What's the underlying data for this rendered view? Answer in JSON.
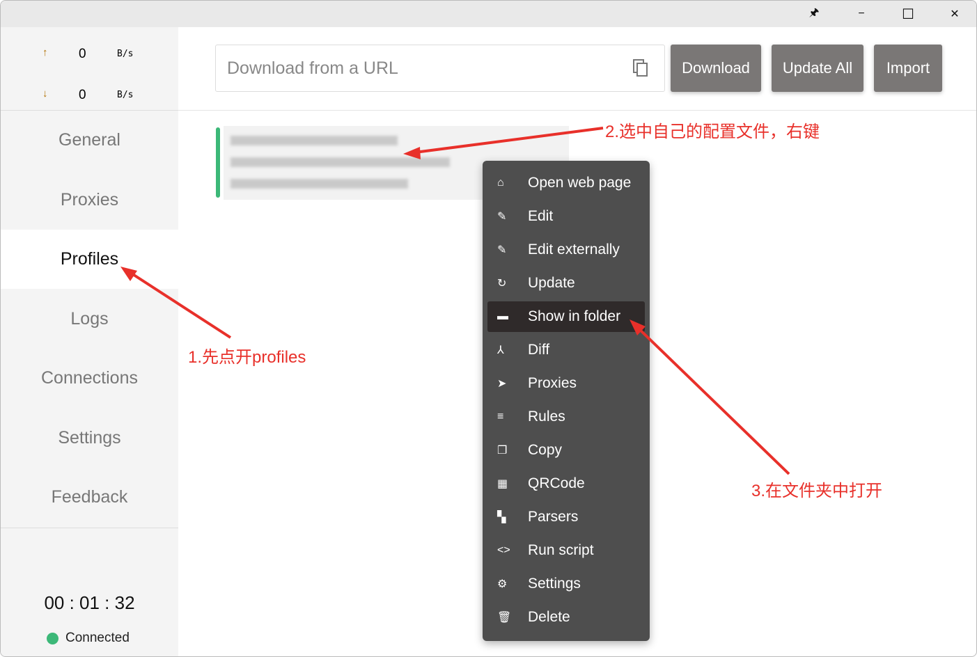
{
  "window": {
    "pin": "🖈",
    "minimize": "−",
    "maximize": "☐",
    "close": "✕"
  },
  "speed": {
    "up": {
      "arrow": "↑",
      "value": "0",
      "unit": "B/s"
    },
    "down": {
      "arrow": "↓",
      "value": "0",
      "unit": "B/s"
    }
  },
  "nav": [
    "General",
    "Proxies",
    "Profiles",
    "Logs",
    "Connections",
    "Settings",
    "Feedback"
  ],
  "active_nav": "Profiles",
  "uptime": "00 : 01 : 32",
  "status": "Connected",
  "toolbar": {
    "url_placeholder": "Download from a URL",
    "download": "Download",
    "update_all": "Update All",
    "import": "Import"
  },
  "menu": [
    {
      "icon": "home",
      "label": "Open web page"
    },
    {
      "icon": "pencil",
      "label": "Edit"
    },
    {
      "icon": "pencil",
      "label": "Edit externally"
    },
    {
      "icon": "refresh",
      "label": "Update"
    },
    {
      "icon": "folder",
      "label": "Show in folder"
    },
    {
      "icon": "merge",
      "label": "Diff"
    },
    {
      "icon": "send",
      "label": "Proxies"
    },
    {
      "icon": "rules",
      "label": "Rules"
    },
    {
      "icon": "copy",
      "label": "Copy"
    },
    {
      "icon": "qrcode",
      "label": "QRCode"
    },
    {
      "icon": "sitemap",
      "label": "Parsers"
    },
    {
      "icon": "code",
      "label": "Run script"
    },
    {
      "icon": "gear",
      "label": "Settings"
    },
    {
      "icon": "trash",
      "label": "Delete"
    }
  ],
  "annotations": {
    "a1": "1.先点开profiles",
    "a2": "2.选中自己的配置文件，右键",
    "a3": "3.在文件夹中打开"
  },
  "colors": {
    "accent": "#3cb878",
    "annotation": "#e8302a",
    "button": "#7a7776"
  }
}
